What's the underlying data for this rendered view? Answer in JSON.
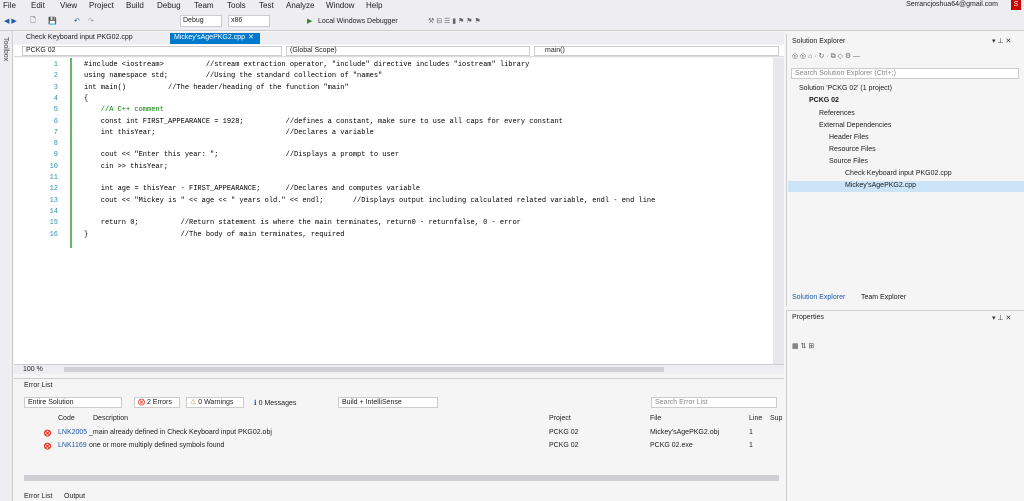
{
  "menu": [
    "File",
    "Edit",
    "View",
    "Project",
    "Build",
    "Debug",
    "Team",
    "Tools",
    "Test",
    "Analyze",
    "Window",
    "Help"
  ],
  "account": "Serrancjoshua64@gmail.com",
  "account_badge": "S",
  "toolbar": {
    "config": "Debug",
    "platform": "x86",
    "debugger": "Local Windows Debugger"
  },
  "toolbox": "Toolbox",
  "tabs": [
    {
      "label": "Check Keyboard input PKG02.cpp"
    },
    {
      "label": "Mickey'sAgePKG2.cpp"
    }
  ],
  "nav": {
    "project": "PCKG 02",
    "scope": "(Global Scope)",
    "member": "main()"
  },
  "code": [
    {
      "n": "1",
      "t": "#include <iostream>          //stream extraction operator, \"include\" directive includes \"iostream\" library"
    },
    {
      "n": "2",
      "t": "using namespace std;         //Using the standard collection of \"names\""
    },
    {
      "n": "3",
      "t": "int main()          //The header/heading of the function \"main\""
    },
    {
      "n": "4",
      "t": "{"
    },
    {
      "n": "5",
      "t": "    //A C++ comment"
    },
    {
      "n": "6",
      "t": "    const int FIRST_APPEARANCE = 1928;          //defines a constant, make sure to use all caps for every constant"
    },
    {
      "n": "7",
      "t": "    int thisYear;                               //Declares a variable"
    },
    {
      "n": "8",
      "t": ""
    },
    {
      "n": "9",
      "t": "    cout << \"Enter this year: \";                //Displays a prompt to user"
    },
    {
      "n": "10",
      "t": "    cin >> thisYear;"
    },
    {
      "n": "11",
      "t": ""
    },
    {
      "n": "12",
      "t": "    int age = thisYear - FIRST_APPEARANCE;      //Declares and computes variable"
    },
    {
      "n": "13",
      "t": "    cout << \"Mickey is \" << age << \" years old.\" << endl;       //Displays output including calculated related variable, endl - end line"
    },
    {
      "n": "14",
      "t": ""
    },
    {
      "n": "15",
      "t": "    return 0;          //Return statement is where the main terminates, return0 - returnfalse, 0 - error"
    },
    {
      "n": "16",
      "t": "}                      //The body of main terminates, required"
    }
  ],
  "zoom": "100 %",
  "errorlist": {
    "title": "Error List",
    "scope": "Entire Solution",
    "errors": "2 Errors",
    "warnings": "0 Warnings",
    "messages": "0 Messages",
    "build": "Build + IntelliSense",
    "search": "Search Error List",
    "headers": [
      "Code",
      "Description",
      "Project",
      "File",
      "Line",
      "Sup"
    ],
    "rows": [
      {
        "code": "LNK2005",
        "desc": "_main already defined in Check Keyboard input PKG02.obj",
        "project": "PCKG 02",
        "file": "Mickey'sAgePKG2.obj",
        "line": "1"
      },
      {
        "code": "LNK1169",
        "desc": "one or more multiply defined symbols found",
        "project": "PCKG 02",
        "file": "PCKG 02.exe",
        "line": "1"
      }
    ],
    "bottom_tabs": [
      "Error List",
      "Output"
    ]
  },
  "solution_explorer": {
    "title": "Solution Explorer",
    "search": "Search Solution Explorer (Ctrl+;)",
    "items": [
      "Solution 'PCKG 02' (1 project)",
      "PCKG 02",
      "References",
      "External Dependencies",
      "Header Files",
      "Resource Files",
      "Source Files",
      "Check Keyboard input PKG02.cpp",
      "Mickey'sAgePKG2.cpp"
    ],
    "tabs": [
      "Solution Explorer",
      "Team Explorer"
    ]
  },
  "properties": {
    "title": "Properties"
  }
}
